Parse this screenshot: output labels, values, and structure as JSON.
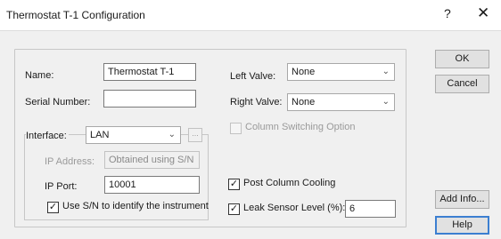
{
  "window": {
    "title": "Thermostat T-1 Configuration",
    "help_glyph": "?",
    "close_glyph": "✕"
  },
  "name_field": {
    "label": "Name:",
    "value": "Thermostat T-1"
  },
  "serial_field": {
    "label": "Serial Number:",
    "value": ""
  },
  "interface": {
    "label": "Interface:",
    "selected": "LAN",
    "browse_label": "..."
  },
  "ip_address": {
    "label": "IP Address:",
    "value": "Obtained using S/N"
  },
  "ip_port": {
    "label": "IP Port:",
    "value": "10001"
  },
  "use_sn": {
    "label": "Use S/N to identify the instrument",
    "checked": true
  },
  "left_valve": {
    "label": "Left Valve:",
    "selected": "None"
  },
  "right_valve": {
    "label": "Right Valve:",
    "selected": "None"
  },
  "column_switching": {
    "label": "Column Switching Option",
    "checked": false
  },
  "post_column_cooling": {
    "label": "Post Column Cooling",
    "checked": true
  },
  "leak_sensor": {
    "label": "Leak Sensor Level (%):",
    "value": "6",
    "checked": true
  },
  "buttons": {
    "ok": "OK",
    "cancel": "Cancel",
    "add_info": "Add Info...",
    "help": "Help"
  },
  "icons": {
    "chevron": "chevron-down-icon",
    "checkmark": "checkmark-icon"
  }
}
